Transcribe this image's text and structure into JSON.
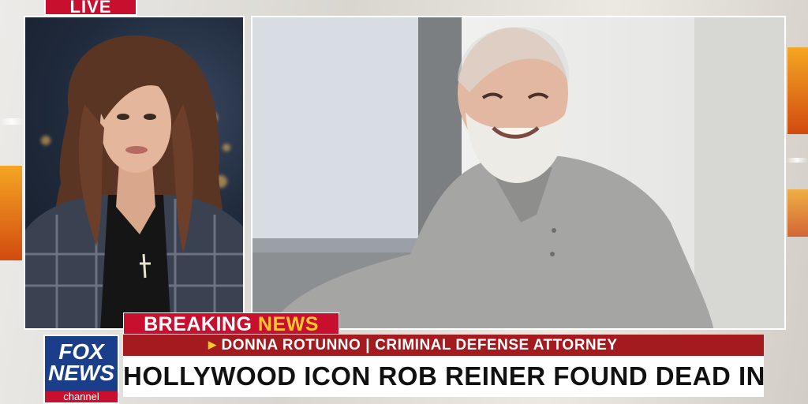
{
  "broadcast": {
    "live_label": "LIVE",
    "breaking_label_part1": "BREAKING",
    "breaking_label_part2": "NEWS",
    "guest_name": "DONNA ROTUNNO",
    "guest_title": "CRIMINAL DEFENSE ATTORNEY",
    "separator": "|",
    "headline": "HOLLYWOOD ICON ROB REINER FOUND DEAD IN L.A. HOME",
    "network_logo": {
      "line1": "FOX",
      "line2": "NEWS",
      "line3": "channel"
    }
  },
  "colors": {
    "brand_red": "#c8102e",
    "name_bar_red": "#a31a1f",
    "accent_yellow": "#ffc72c",
    "logo_blue": "#1b3e8a"
  },
  "icons": {
    "name_bar_marker": "play-triangle-icon"
  }
}
